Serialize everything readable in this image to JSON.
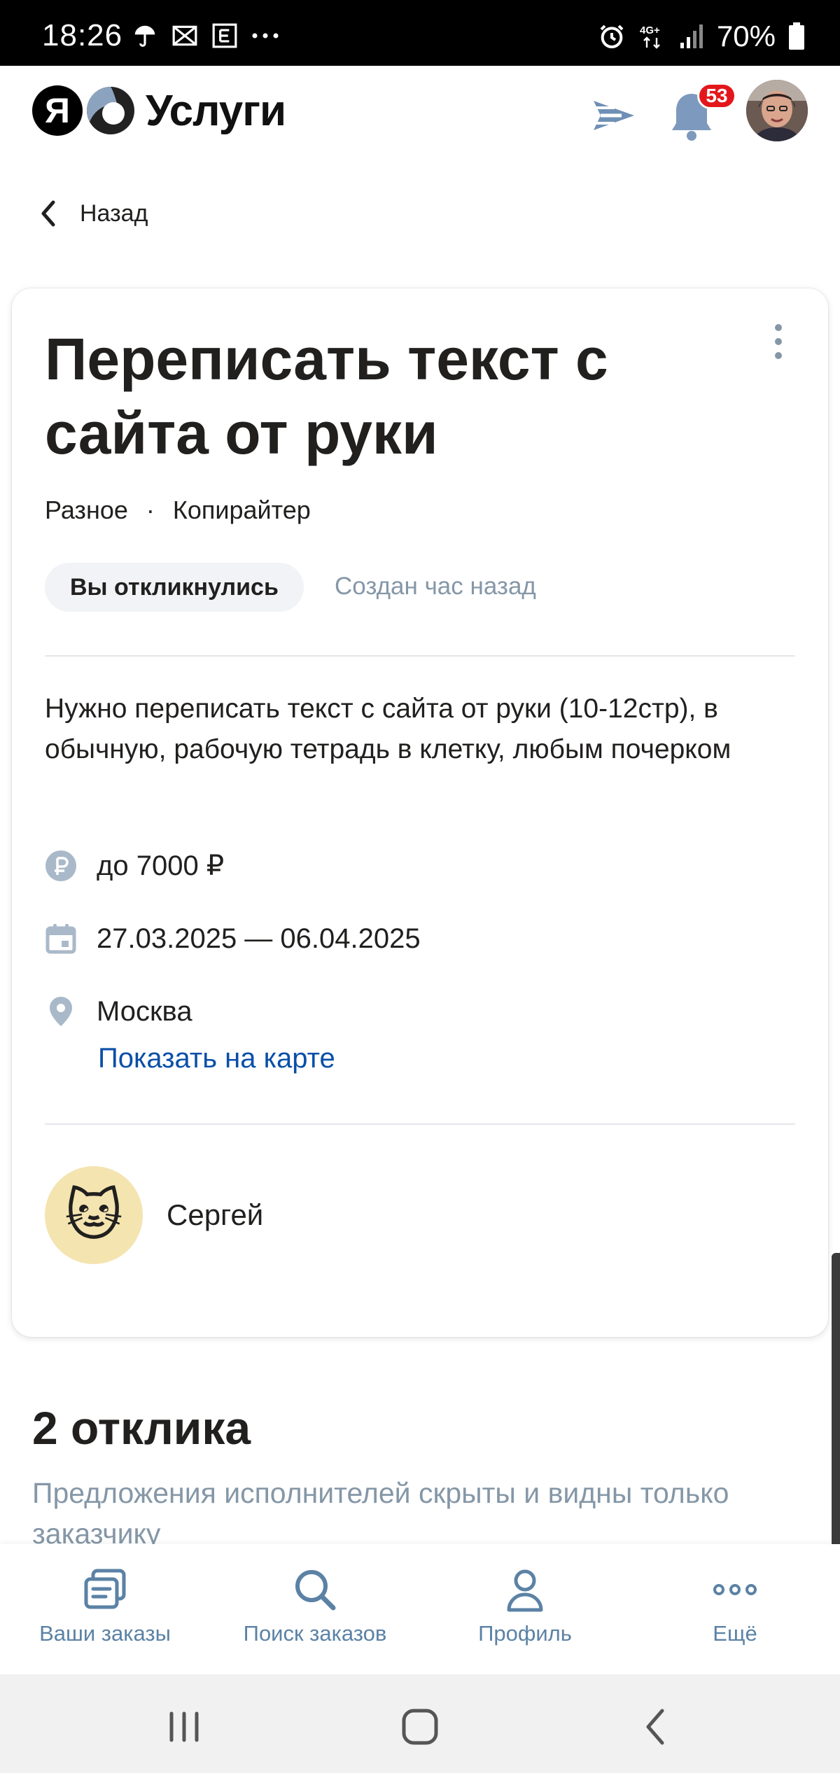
{
  "status_bar": {
    "time": "18:26",
    "battery_text": "70%",
    "network": "4G+",
    "icons_left": [
      "umbrella-icon",
      "cross-box-icon",
      "e-box-icon",
      "more-dots-icon"
    ],
    "icons_right": [
      "alarm-icon",
      "network-4g-icon",
      "signal-icon",
      "battery-icon"
    ]
  },
  "header": {
    "logo_letter": "Я",
    "logo_text": "Услуги",
    "notification_count": "53"
  },
  "back": {
    "label": "Назад"
  },
  "order": {
    "title": "Переписать текст с сайта от руки",
    "category": "Разное",
    "separator": "·",
    "subcategory": "Копирайтер",
    "status": "Вы откликнулись",
    "created": "Создан час назад",
    "description": "Нужно переписать текст с сайта от руки (10-12стр), в обычную, рабочую тетрадь в клетку, любым почерком",
    "price": "до 7000 ₽",
    "dates": "27.03.2025 — 06.04.2025",
    "city": "Москва",
    "map_link": "Показать на карте",
    "author": {
      "name": "Сергей",
      "avatar_emoji": "🐱"
    }
  },
  "responses": {
    "title": "2 отклика",
    "note": "Предложения исполнителей скрыты и видны только заказчику"
  },
  "bottom_nav": [
    {
      "label": "Ваши заказы",
      "icon": "orders-icon"
    },
    {
      "label": "Поиск заказов",
      "icon": "search-icon"
    },
    {
      "label": "Профиль",
      "icon": "profile-icon"
    },
    {
      "label": "Ещё",
      "icon": "more-icon"
    }
  ],
  "colors": {
    "accent_link": "#0a4fa8",
    "muted": "#8597a7",
    "nav": "#5b82a5",
    "badge": "#e3171b"
  }
}
